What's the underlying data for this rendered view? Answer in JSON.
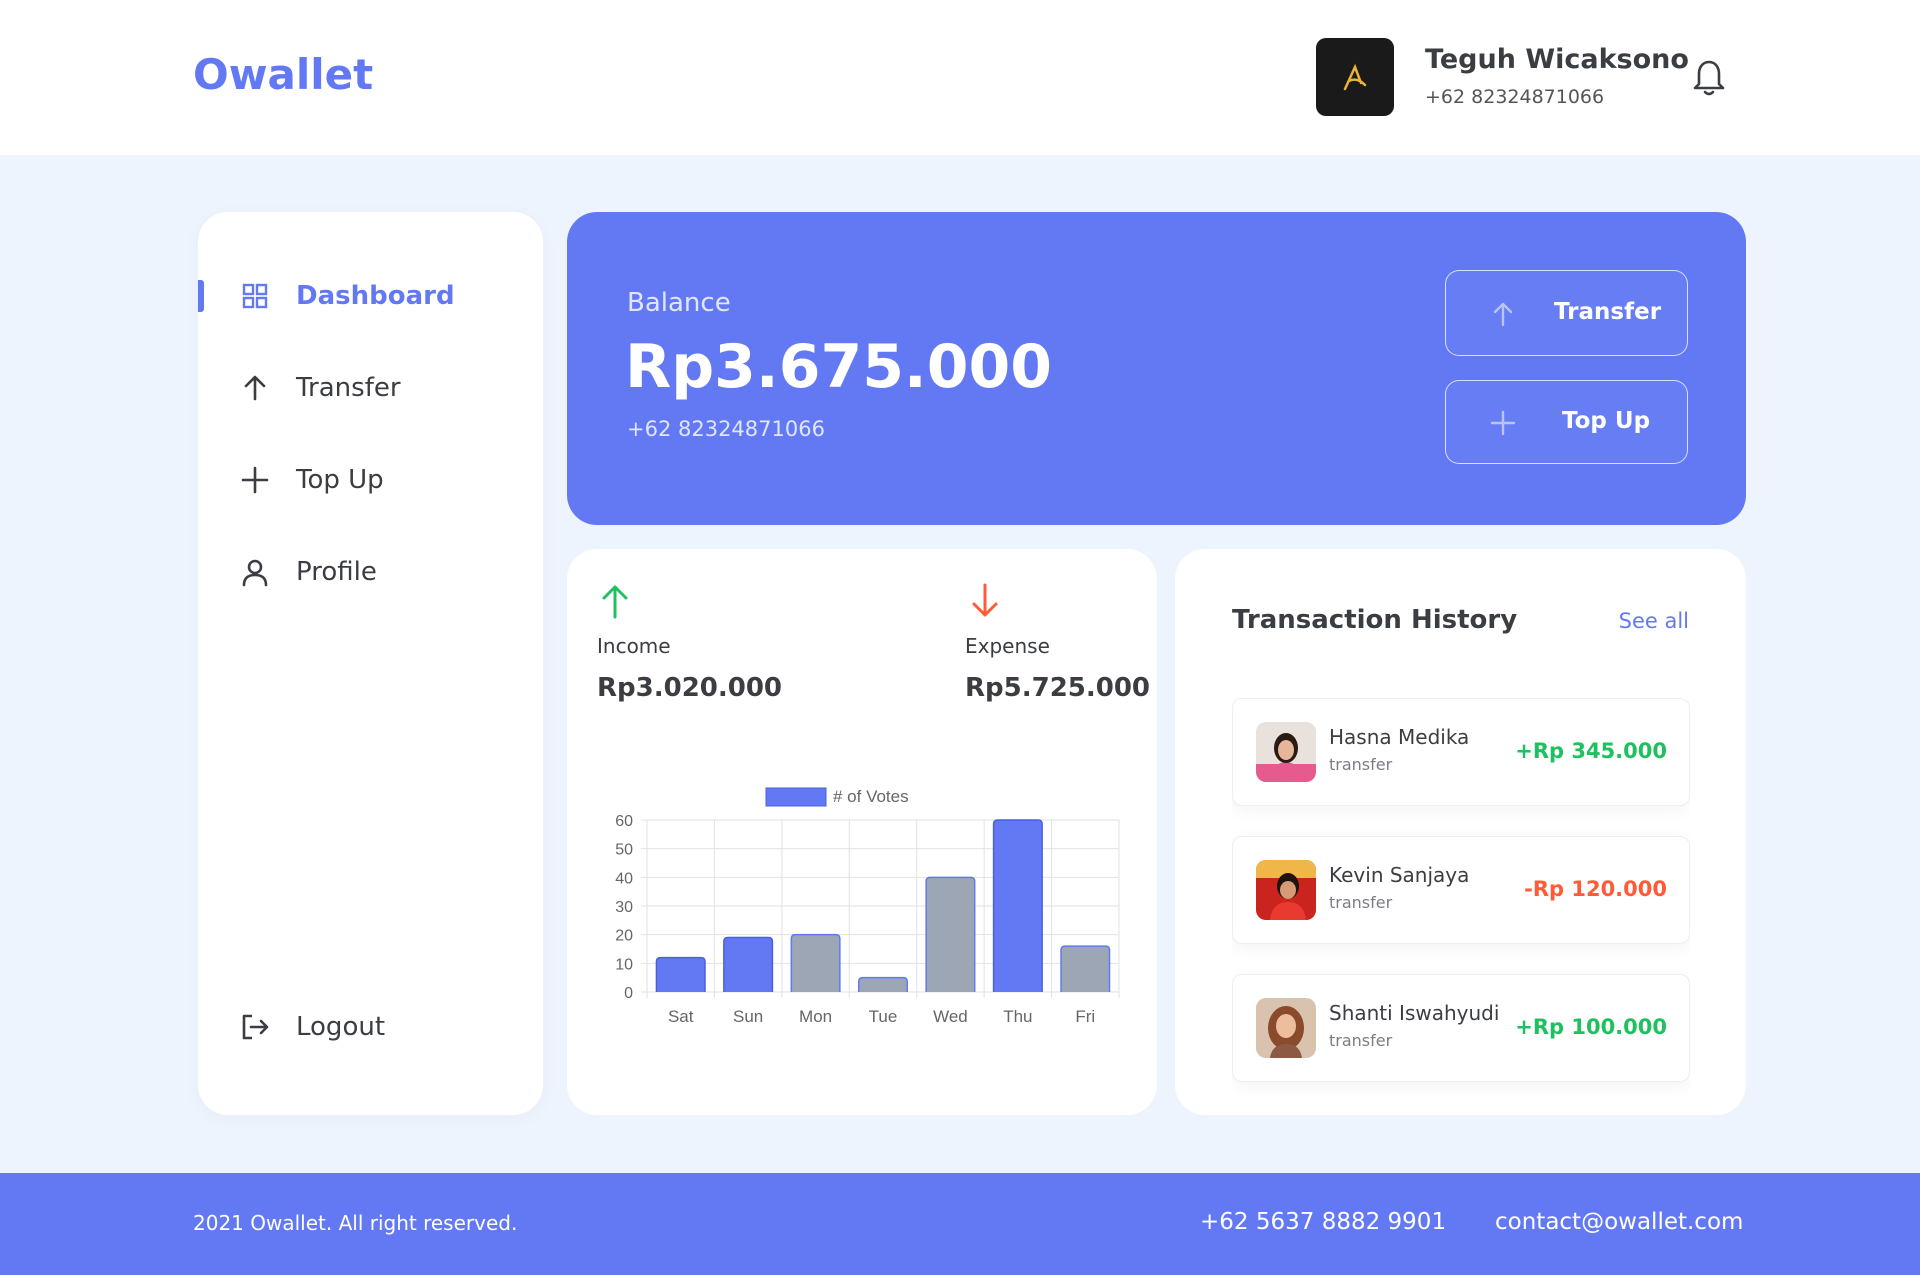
{
  "header": {
    "brand": "Owallet",
    "user_name": "Teguh Wicaksono",
    "user_phone": "+62 82324871066"
  },
  "sidebar": {
    "items": [
      {
        "label": "Dashboard",
        "icon": "grid-icon",
        "active": true
      },
      {
        "label": "Transfer",
        "icon": "arrow-up-icon",
        "active": false
      },
      {
        "label": "Top Up",
        "icon": "plus-icon",
        "active": false
      },
      {
        "label": "Profile",
        "icon": "user-icon",
        "active": false
      }
    ],
    "logout_label": "Logout"
  },
  "balance": {
    "label": "Balance",
    "amount": "Rp3.675.000",
    "phone": "+62 82324871066",
    "transfer_label": "Transfer",
    "topup_label": "Top Up"
  },
  "stats": {
    "income_label": "Income",
    "income_value": "Rp3.020.000",
    "expense_label": "Expense",
    "expense_value": "Rp5.725.000"
  },
  "chart_data": {
    "type": "bar",
    "categories": [
      "Sat",
      "Sun",
      "Mon",
      "Tue",
      "Wed",
      "Thu",
      "Fri"
    ],
    "series": [
      {
        "name": "# of Votes",
        "values": [
          12,
          19,
          20,
          5,
          40,
          60,
          16
        ]
      }
    ],
    "bar_colors": [
      "#6379F4",
      "#6379F4",
      "#9DA6B5",
      "#9DA6B5",
      "#9DA6B5",
      "#6379F4",
      "#9DA6B5"
    ],
    "ylim": [
      0,
      60
    ],
    "yticks": [
      0,
      10,
      20,
      30,
      40,
      50,
      60
    ],
    "grid": true,
    "legend": "top"
  },
  "history": {
    "title": "Transaction History",
    "see_all": "See all",
    "items": [
      {
        "name": "Hasna Medika",
        "type": "transfer",
        "amount": "+Rp 345.000",
        "color": "#1EC15F"
      },
      {
        "name": "Kevin Sanjaya",
        "type": "transfer",
        "amount": "-Rp 120.000",
        "color": "#FF5B37"
      },
      {
        "name": "Shanti Iswahyudi",
        "type": "transfer",
        "amount": "+Rp 100.000",
        "color": "#1EC15F"
      }
    ]
  },
  "footer": {
    "copyright": "2021 Owallet. All right reserved.",
    "phone": "+62 5637 8882 9901",
    "email": "contact@owallet.com"
  },
  "colors": {
    "primary": "#6379F4",
    "income": "#1EC15F",
    "expense": "#FF5B37",
    "background": "#EEF4FD"
  }
}
